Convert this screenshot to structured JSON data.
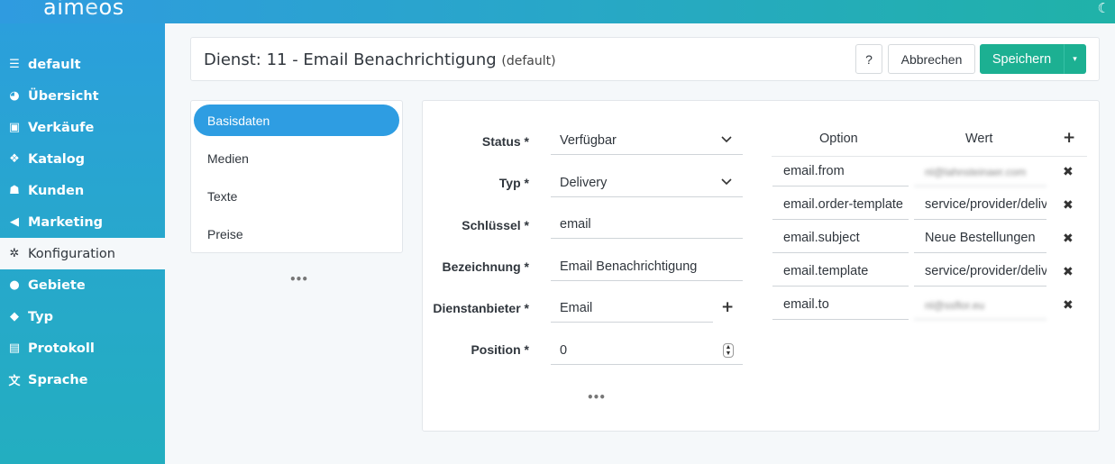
{
  "brand": {
    "logo": "aimeos",
    "theme_icon": "moon-icon"
  },
  "sidebar": {
    "items": [
      {
        "label": "default",
        "icon": "list-icon",
        "glyph": "☰"
      },
      {
        "label": "Übersicht",
        "icon": "dashboard-icon",
        "glyph": "◕"
      },
      {
        "label": "Verkäufe",
        "icon": "money-icon",
        "glyph": "▣"
      },
      {
        "label": "Katalog",
        "icon": "cubes-icon",
        "glyph": "❖"
      },
      {
        "label": "Kunden",
        "icon": "users-icon",
        "glyph": "☗"
      },
      {
        "label": "Marketing",
        "icon": "megaphone-icon",
        "glyph": "◀"
      },
      {
        "label": "Konfiguration",
        "icon": "cogs-icon",
        "glyph": "✲"
      },
      {
        "label": "Gebiete",
        "icon": "globe-icon",
        "glyph": "●"
      },
      {
        "label": "Typ",
        "icon": "tag-icon",
        "glyph": "◆"
      },
      {
        "label": "Protokoll",
        "icon": "archive-icon",
        "glyph": "▤"
      },
      {
        "label": "Sprache",
        "icon": "language-icon",
        "glyph": "文"
      }
    ],
    "active_index": 6
  },
  "header": {
    "title": "Dienst: 11 - Email Benachrichtigung",
    "site": "(default)",
    "help_label": "?",
    "cancel_label": "Abbrechen",
    "save_label": "Speichern",
    "save_menu_glyph": "▾"
  },
  "nav": {
    "items": [
      "Basisdaten",
      "Medien",
      "Texte",
      "Preise"
    ],
    "active_index": 0,
    "more": "•••"
  },
  "form": {
    "status": {
      "label": "Status *",
      "value": "Verfügbar"
    },
    "type": {
      "label": "Typ *",
      "value": "Delivery"
    },
    "code": {
      "label": "Schlüssel *",
      "value": "email"
    },
    "name": {
      "label": "Bezeichnung *",
      "value": "Email Benachrichtigung"
    },
    "provider": {
      "label": "Dienstanbieter *",
      "value": "Email"
    },
    "position": {
      "label": "Position *",
      "value": "0"
    },
    "more": "•••"
  },
  "options": {
    "headers": {
      "option": "Option",
      "value": "Wert"
    },
    "add_glyph": "+",
    "remove_glyph": "✖",
    "rows": [
      {
        "key": "email.from",
        "value": "nl@lahnsteinaer.com"
      },
      {
        "key": "email.order-template",
        "value": "service/provider/delivery"
      },
      {
        "key": "email.subject",
        "value": "Neue Bestellungen"
      },
      {
        "key": "email.template",
        "value": "service/provider/delivery"
      },
      {
        "key": "email.to",
        "value": "nl@ssflor.eu"
      }
    ]
  }
}
